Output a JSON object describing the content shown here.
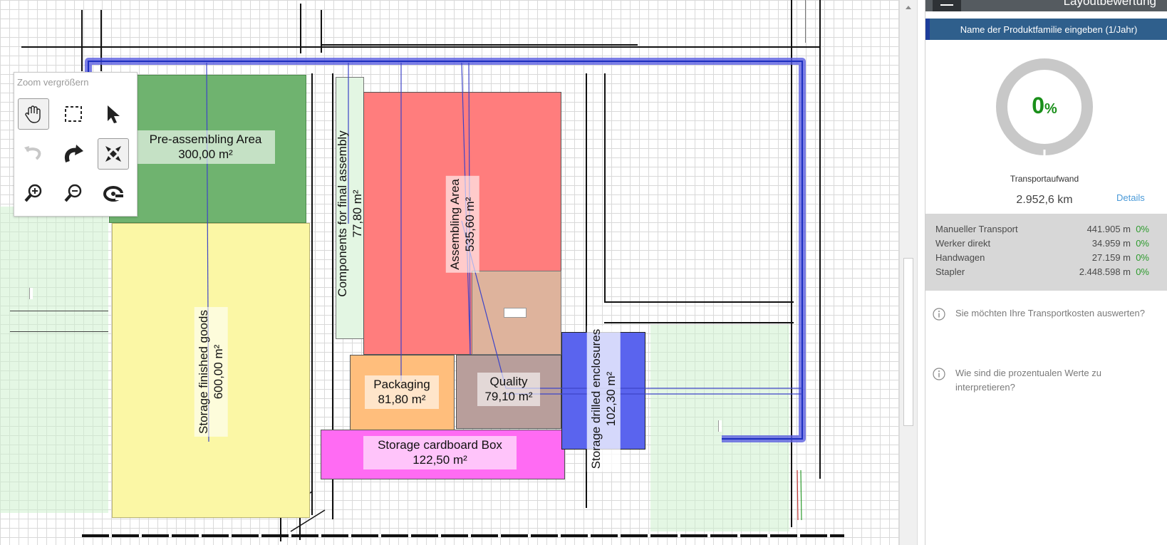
{
  "toolbox": {
    "title": "Zoom vergrößern",
    "tools": [
      "pan-hand-icon",
      "select-rectangle-icon",
      "pointer-arrow-icon",
      "undo-icon",
      "redo-icon",
      "fit-to-screen-icon",
      "zoom-in-icon",
      "zoom-out-icon",
      "rotate-view-icon"
    ]
  },
  "areas": {
    "pre_assembling": {
      "name": "Pre-assembling Area",
      "size": "300,00 m²",
      "color": "#6fb36f"
    },
    "storage_finished": {
      "name": "Storage finished goods",
      "size": "600,00 m²",
      "color": "#fbf7a5"
    },
    "components": {
      "name": "Components for final assembly",
      "size": "77,80 m²",
      "color": "#e3f6e3"
    },
    "assembling": {
      "name": "Assembling Area",
      "size": "535,60 m²",
      "color": "#ff7d7d"
    },
    "packaging": {
      "name": "Packaging",
      "size": "81,80 m²",
      "color": "#ffbe7c"
    },
    "quality": {
      "name": "Quality",
      "size": "79,10 m²",
      "color": "#b89e9b"
    },
    "storage_cardboard": {
      "name": "Storage cardboard Box",
      "size": "122,50 m²",
      "color": "#ff6bf3"
    },
    "storage_drilled": {
      "name": "Storage drilled enclosures",
      "size": "102,30 m²",
      "color": "#5a64ee"
    }
  },
  "panel": {
    "title": "Layoutbewertung",
    "family_header": "Name der Produktfamilie eingeben (1/Jahr)",
    "gauge_value": "0",
    "gauge_unit": "%",
    "gauge_fraction": 0,
    "transport_label": "Transportaufwand",
    "transport_value": "2.952,6 km",
    "details_link": "Details",
    "stats": [
      {
        "name": "Manueller Transport",
        "value": "441.905 m",
        "pct": "0%"
      },
      {
        "name": "Werker direkt",
        "value": "34.959 m",
        "pct": "0%"
      },
      {
        "name": "Handwagen",
        "value": "27.159 m",
        "pct": "0%"
      },
      {
        "name": "Stapler",
        "value": "2.448.598 m",
        "pct": "0%"
      }
    ],
    "info1": "Sie möchten Ihre Transportkosten auswerten?",
    "info2": "Wie sind die prozentualen Werte zu interpretieren?"
  },
  "colors": {
    "accent_blue": "#2f5f8c",
    "gauge_gray": "#c8c8c8",
    "gauge_value_green": "#1a8f1a",
    "path_blue": "#5a5ee0"
  }
}
